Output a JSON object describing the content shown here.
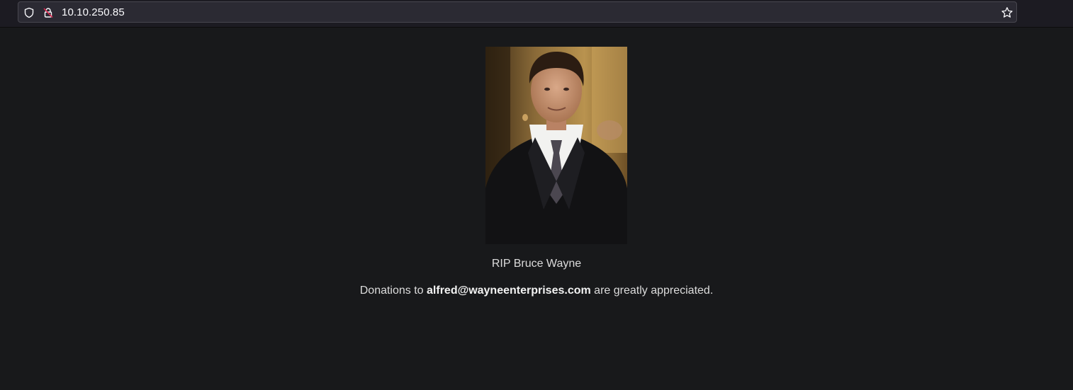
{
  "browser": {
    "url": "10.10.250.85",
    "icons": {
      "tracking": "shield-icon",
      "security": "insecure-lock-icon",
      "bookmark": "star-icon"
    }
  },
  "page": {
    "background": "#18191b",
    "portrait_alt": "Portrait of Bruce Wayne",
    "caption": "RIP Bruce Wayne",
    "donation_prefix": "Donations to ",
    "donation_email": "alfred@wayneenterprises.com",
    "donation_suffix": " are greatly appreciated."
  }
}
